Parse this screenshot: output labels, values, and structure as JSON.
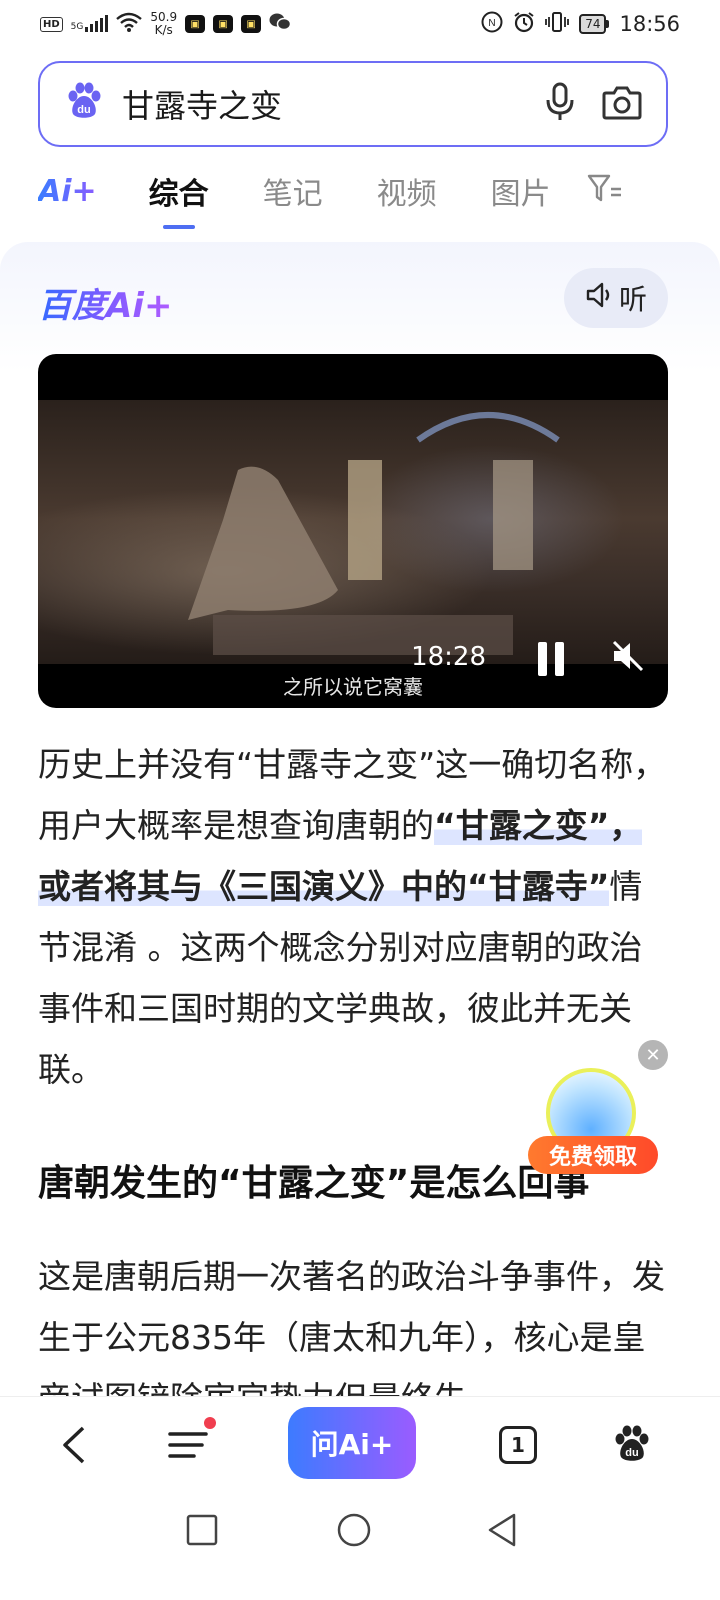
{
  "status_bar": {
    "hd_label": "HD",
    "signal_label": "5G",
    "net_speed_value": "50.9",
    "net_speed_unit": "K/s",
    "battery_level": "74",
    "time": "18:56",
    "icons": [
      "signal-icon",
      "wifi-icon",
      "app-badge-icon",
      "wechat-icon",
      "nfc-icon",
      "alarm-icon",
      "vibrate-icon",
      "battery-icon"
    ]
  },
  "search": {
    "query": "甘露寺之变",
    "icons": [
      "baidu-paw-icon",
      "microphone-icon",
      "camera-icon"
    ]
  },
  "tabs": {
    "ai_logo": "Ai+",
    "items": [
      {
        "label": "综合",
        "active": true
      },
      {
        "label": "笔记",
        "active": false
      },
      {
        "label": "视频",
        "active": false
      },
      {
        "label": "图片",
        "active": false
      }
    ]
  },
  "ai_section": {
    "brand": "百度Ai+",
    "listen_label": "听"
  },
  "video": {
    "time": "18:28",
    "subtitle": "之所以说它窝囊"
  },
  "article": {
    "p1_a": "历史上并没有“甘露寺之变”这一确切名称，用户大概率是想查询唐朝的",
    "p1_b": "“甘露之变”，或者将其与《三国演义》中的“甘露寺”",
    "p1_c": "情节混淆 。这两个概念分别对应唐朝的政治事件和三国时期的文学典故，彼此并无关联。",
    "heading": "唐朝发生的“甘露之变”是怎么回事",
    "p2": "这是唐朝后期一次著名的政治斗争事件，发生于公元835年（唐太和九年），核心是皇帝试图铲除宦官势力但最终失"
  },
  "promo": {
    "label": "免费领取"
  },
  "bottom_nav": {
    "ask_ai_label": "问Ai+",
    "tab_count": "1"
  },
  "colors": {
    "accent": "#4e6ef2",
    "search_border": "#6d6df5",
    "promo": "#ff5a2a"
  }
}
